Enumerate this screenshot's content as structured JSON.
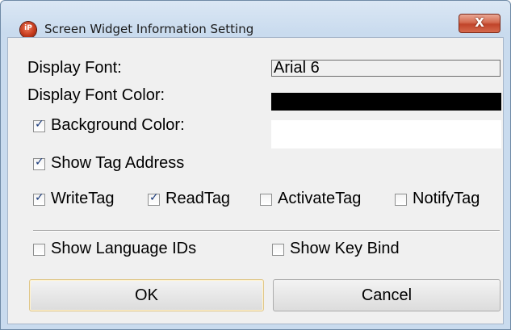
{
  "window": {
    "title": "Screen Widget Information Setting",
    "close_glyph": "X",
    "icon_label": "iP",
    "icon_name": "app-icon",
    "accent_color": "#c9dbee"
  },
  "settings": {
    "display_font_label": "Display Font:",
    "display_font_value": "Arial 6",
    "display_font_color_label": "Display Font Color:",
    "display_font_color": "#000000",
    "background_color_label": "Background Color:",
    "background_color_checked": true,
    "background_color": "#ffffff",
    "show_tag_address_label": "Show Tag Address",
    "show_tag_address_checked": true
  },
  "tags": [
    {
      "label": "WriteTag",
      "checked": true
    },
    {
      "label": "ReadTag",
      "checked": true
    },
    {
      "label": "ActivateTag",
      "checked": false
    },
    {
      "label": "NotifyTag",
      "checked": false
    }
  ],
  "options": {
    "show_language_ids_label": "Show Language IDs",
    "show_language_ids_checked": false,
    "show_key_bind_label": "Show Key Bind",
    "show_key_bind_checked": false
  },
  "buttons": {
    "ok_label": "OK",
    "cancel_label": "Cancel"
  }
}
